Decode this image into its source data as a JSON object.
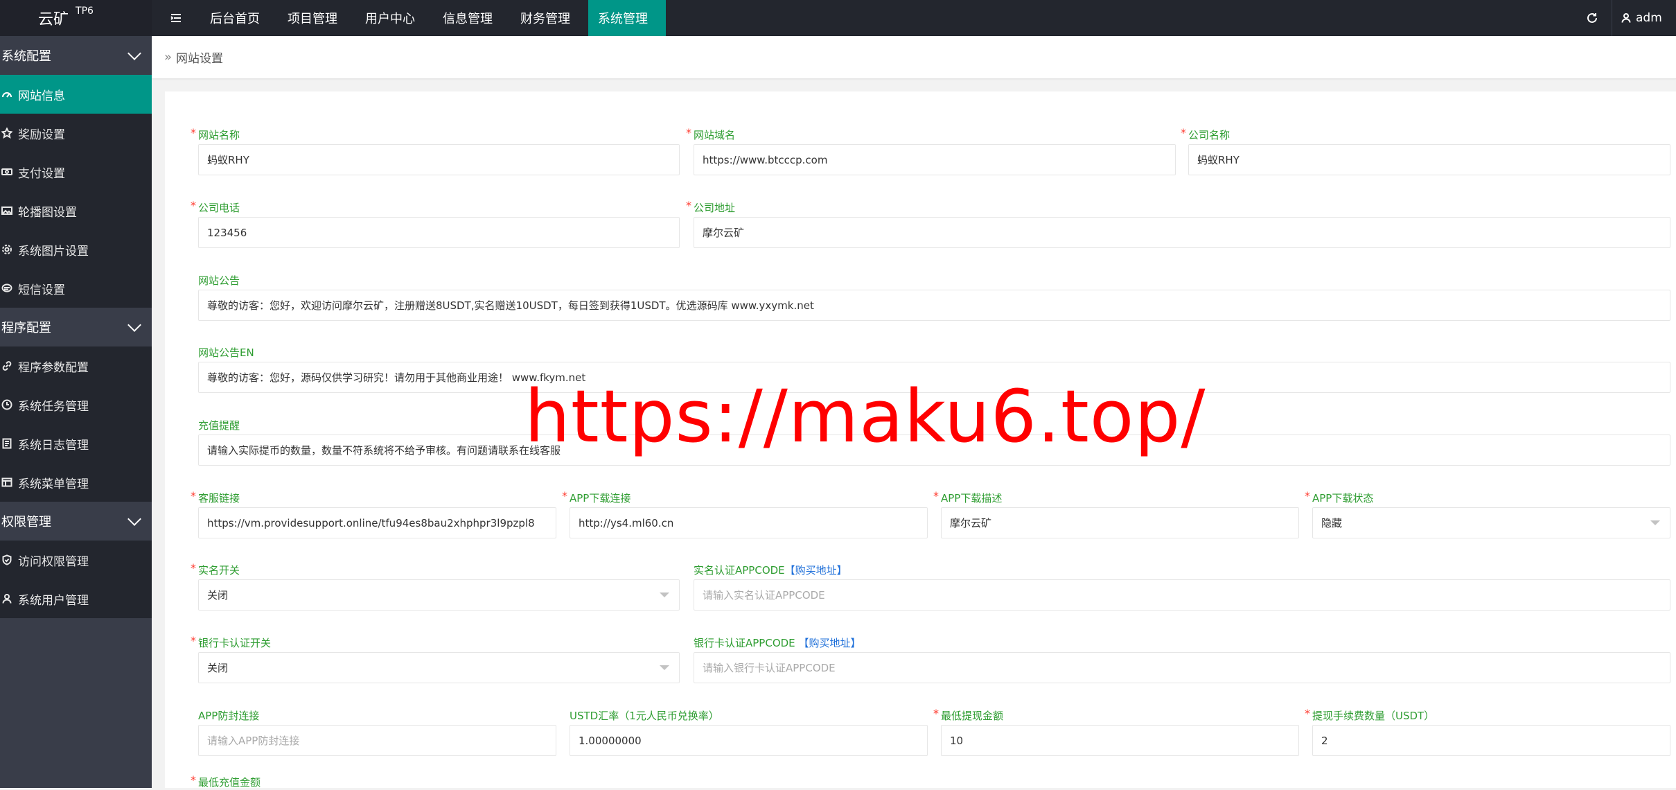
{
  "logo": {
    "title": "云矿",
    "badge": "TP6"
  },
  "header": {
    "nav": [
      {
        "label": "后台首页",
        "active": false
      },
      {
        "label": "项目管理",
        "active": false
      },
      {
        "label": "用户中心",
        "active": false
      },
      {
        "label": "信息管理",
        "active": false
      },
      {
        "label": "财务管理",
        "active": false
      },
      {
        "label": "系统管理",
        "active": true
      }
    ],
    "user": "adm"
  },
  "sidebar": {
    "groups": [
      {
        "label": "系统配置",
        "items": [
          {
            "label": "网站信息",
            "icon": "dashboard-icon",
            "active": true
          },
          {
            "label": "奖励设置",
            "icon": "star-icon"
          },
          {
            "label": "支付设置",
            "icon": "money-icon"
          },
          {
            "label": "轮播图设置",
            "icon": "picture-icon"
          },
          {
            "label": "系统图片设置",
            "icon": "gear-icon"
          },
          {
            "label": "短信设置",
            "icon": "message-icon"
          }
        ]
      },
      {
        "label": "程序配置",
        "items": [
          {
            "label": "程序参数配置",
            "icon": "link-icon"
          },
          {
            "label": "系统任务管理",
            "icon": "clock-icon"
          },
          {
            "label": "系统日志管理",
            "icon": "log-icon"
          },
          {
            "label": "系统菜单管理",
            "icon": "table-icon"
          }
        ]
      },
      {
        "label": "权限管理",
        "items": [
          {
            "label": "访问权限管理",
            "icon": "shield-icon"
          },
          {
            "label": "系统用户管理",
            "icon": "user-icon"
          }
        ]
      }
    ]
  },
  "breadcrumb": "网站设置",
  "form": {
    "site_name": {
      "label": "网站名称",
      "value": "蚂蚁RHY"
    },
    "site_domain": {
      "label": "网站域名",
      "value": "https://www.btcccp.com"
    },
    "company_name": {
      "label": "公司名称",
      "value": "蚂蚁RHY"
    },
    "company_phone": {
      "label": "公司电话",
      "value": "123456"
    },
    "company_address": {
      "label": "公司地址",
      "value": "摩尔云矿"
    },
    "notice": {
      "label": "网站公告",
      "value": "尊敬的访客：您好，欢迎访问摩尔云矿，注册赠送8USDT,实名赠送10USDT，每日签到获得1USDT。优选源码库  www.yxymk.net"
    },
    "notice_en": {
      "label": "网站公告EN",
      "value": "尊敬的访客：您好，源码仅供学习研究！请勿用于其他商业用途！  www.fkym.net"
    },
    "recharge_tip": {
      "label": "充值提醒",
      "value": "请输入实际提币的数量，数量不符系统将不给予审核。有问题请联系在线客服"
    },
    "service_link": {
      "label": "客服链接",
      "value": "https://vm.providesupport.online/tfu94es8bau2xhphpr3l9pzpl8"
    },
    "app_download": {
      "label": "APP下载连接",
      "value": "http://ys4.ml60.cn"
    },
    "app_desc": {
      "label": "APP下载描述",
      "value": "摩尔云矿"
    },
    "app_status": {
      "label": "APP下载状态",
      "value": "隐藏"
    },
    "realname_switch": {
      "label": "实名开关",
      "value": "关闭"
    },
    "realname_appcode": {
      "label": "实名认证APPCODE",
      "buy": "【购买地址】",
      "placeholder": "请输入实名认证APPCODE"
    },
    "bank_switch": {
      "label": "银行卡认证开关",
      "value": "关闭"
    },
    "bank_appcode": {
      "label": "银行卡认证APPCODE",
      "buy": " 【购买地址】",
      "placeholder": "请输入银行卡认证APPCODE"
    },
    "app_antiblock": {
      "label": "APP防封连接",
      "placeholder": "请输入APP防封连接"
    },
    "usdt_rate": {
      "label": "USTD汇率（1元人民币兑换率）",
      "value": "1.00000000"
    },
    "min_withdraw": {
      "label": "最低提现金额",
      "value": "10"
    },
    "withdraw_fee": {
      "label": "提现手续费数量（USDT）",
      "value": "2"
    },
    "min_recharge": {
      "label": "最低充值金额"
    }
  },
  "watermark": "https://maku6.top/",
  "colors": {
    "accent": "#009688",
    "label": "#2e9d31",
    "required": "#ff3b30",
    "link": "#1e6fd9",
    "watermark": "#ff0000"
  }
}
